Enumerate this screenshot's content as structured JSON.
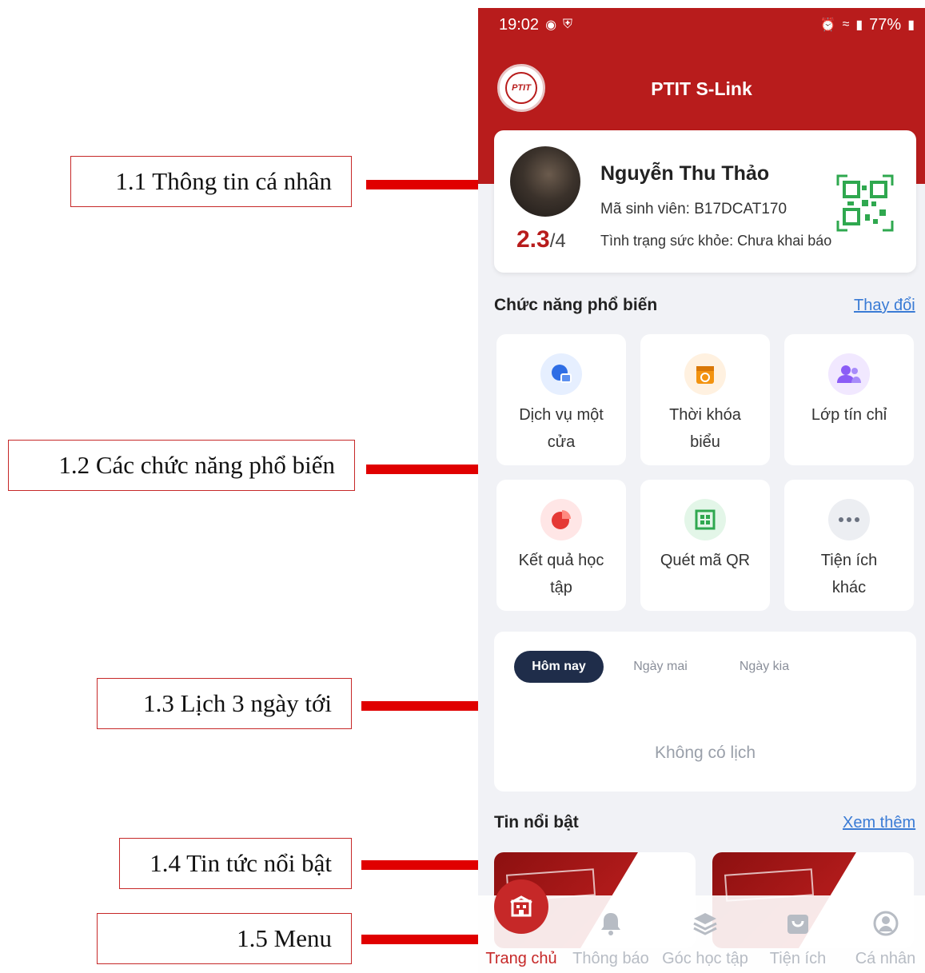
{
  "annotations": [
    {
      "label": "1.1 Thông tin cá nhân"
    },
    {
      "label": "1.2 Các chức năng phổ biến"
    },
    {
      "label": "1.3 Lịch 3 ngày tới"
    },
    {
      "label": "1.4 Tin tức nổi bật"
    },
    {
      "label": "1.5 Menu"
    }
  ],
  "status_bar": {
    "time": "19:02",
    "battery": "77%"
  },
  "header": {
    "title": "PTIT S-Link",
    "logo_text": "PTIT"
  },
  "profile": {
    "name": "Nguyễn Thu Thảo",
    "student_id": "Mã sinh viên: B17DCAT170",
    "health": "Tình trạng sức khỏe: Chưa khai báo",
    "gpa_value": "2.3",
    "gpa_scale": "/4"
  },
  "popular": {
    "title": "Chức năng phổ biến",
    "link": "Thay đổi",
    "items": [
      {
        "line1": "Dịch vụ một",
        "line2": "cửa"
      },
      {
        "line1": "Thời khóa",
        "line2": "biểu"
      },
      {
        "line1": "Lớp tín chỉ",
        "line2": ""
      },
      {
        "line1": "Kết quả học",
        "line2": "tập"
      },
      {
        "line1": "Quét mã QR",
        "line2": ""
      },
      {
        "line1": "Tiện ích",
        "line2": "khác"
      }
    ]
  },
  "schedule": {
    "tabs": [
      "Hôm nay",
      "Ngày mai",
      "Ngày kia"
    ],
    "empty_text": "Không có lịch"
  },
  "news": {
    "title": "Tin nổi bật",
    "link": "Xem thêm"
  },
  "bottom_nav": [
    "Trang chủ",
    "Thông báo",
    "Góc học tập",
    "Tiện ích",
    "Cá nhân"
  ],
  "colors": {
    "brand_red": "#b81c1c",
    "link_blue": "#3a7bd5",
    "active_tab": "#1f2d4a"
  }
}
